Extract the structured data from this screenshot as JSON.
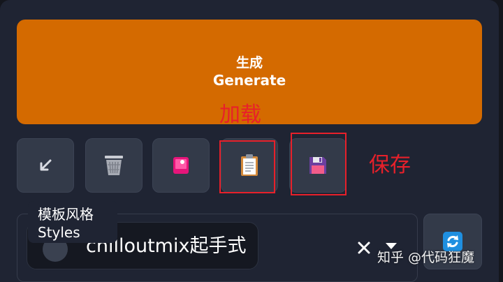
{
  "generate": {
    "label_zh": "生成",
    "label_en": "Generate"
  },
  "annotations": {
    "load": "加载",
    "save": "保存"
  },
  "toolbar": {
    "buttons": [
      {
        "icon": "arrow-down-left-icon"
      },
      {
        "icon": "trash-icon"
      },
      {
        "icon": "image-icon"
      },
      {
        "icon": "clipboard-icon"
      },
      {
        "icon": "floppy-disk-icon"
      }
    ]
  },
  "styles": {
    "label_zh": "模板风格",
    "label_en": "Styles",
    "selected_value": "chilloutmix起手式",
    "refresh_icon": "refresh-icon"
  },
  "watermark": "知乎 @代码狂魔",
  "colors": {
    "generate_bg": "#d46a00",
    "annotation": "#e8202a",
    "panel_bg": "#1f2433",
    "button_bg": "#333a49"
  }
}
